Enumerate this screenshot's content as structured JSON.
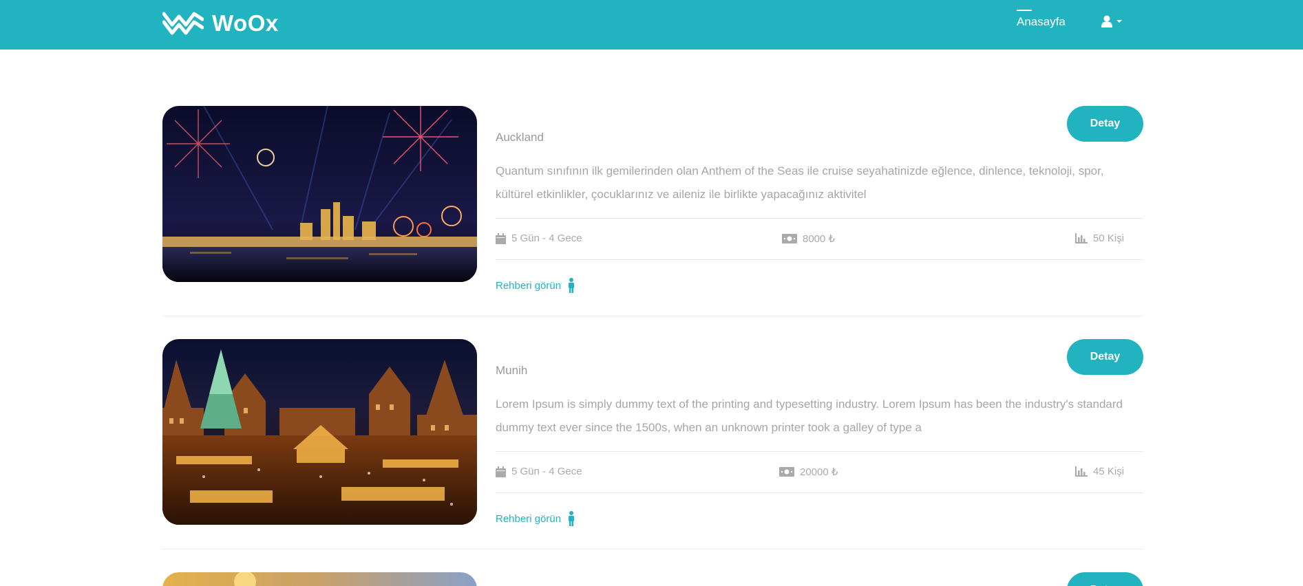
{
  "header": {
    "brand": "WoOx",
    "nav_home": "Anasayfa"
  },
  "colors": {
    "accent": "#22b3c1",
    "muted_text": "#a6a6a6"
  },
  "tours": [
    {
      "city": "Auckland",
      "description": "Quantum sınıfının ilk gemilerinden olan Anthem of the Seas ile cruise seyahatinizde eğlence, dinlence, teknoloji, spor, kültürel etkinlikler, çocuklarınız ve aileniz ile birlikte yapacağınız aktivitel",
      "duration": "5 Gün - 4 Gece",
      "price": "8000 ₺",
      "capacity": "50 Kişi",
      "detail_label": "Detay",
      "guide_label": "Rehberi görün"
    },
    {
      "city": "Munih",
      "description": "Lorem Ipsum is simply dummy text of the printing and typesetting industry. Lorem Ipsum has been the industry's standard dummy text ever since the 1500s, when an unknown printer took a galley of type a",
      "duration": "5 Gün - 4 Gece",
      "price": "20000 ₺",
      "capacity": "45 Kişi",
      "detail_label": "Detay",
      "guide_label": "Rehberi görün"
    },
    {
      "detail_label": "Detay"
    }
  ]
}
